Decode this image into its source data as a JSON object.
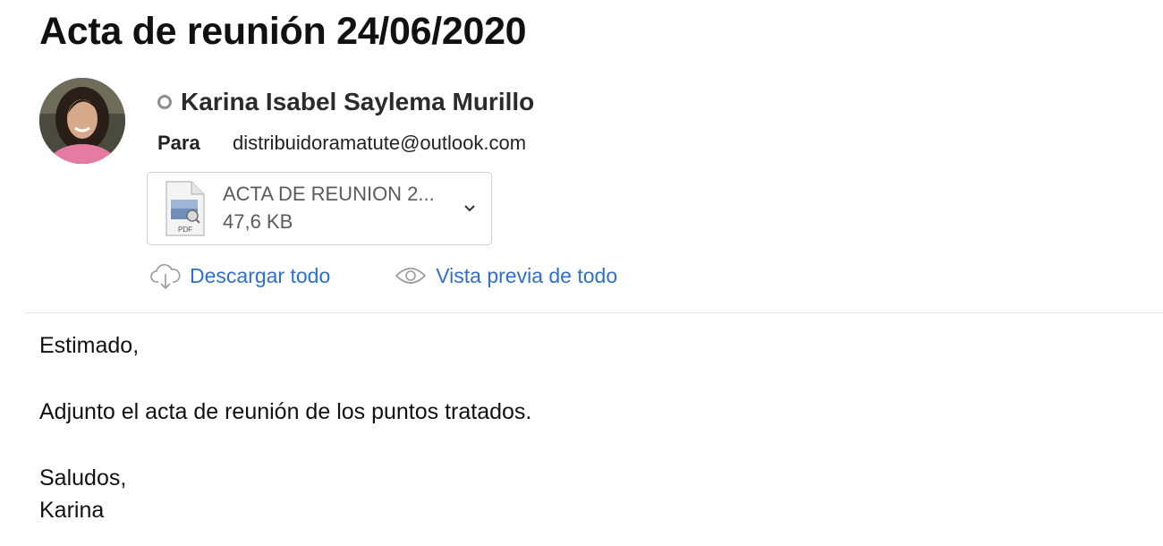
{
  "message": {
    "subject": "Acta de reunión 24/06/2020",
    "sender": {
      "name": "Karina Isabel Saylema Murillo"
    },
    "to": {
      "label": "Para",
      "address": "distribuidoramatute@outlook.com"
    },
    "attachment": {
      "name": "ACTA DE REUNION 2...",
      "size": "47,6 KB",
      "icon": "pdf-file-icon",
      "icon_badge": "PDF"
    },
    "actions": {
      "download_all": "Descargar todo",
      "preview_all": "Vista previa de todo"
    },
    "body": {
      "greeting": "Estimado,",
      "line1": "Adjunto el acta de reunión de los puntos tratados.",
      "closing": "Saludos,",
      "signature": "Karina"
    }
  },
  "colors": {
    "link": "#2e6fce",
    "presence": "#8e8e93",
    "border": "#d0d0d0"
  }
}
